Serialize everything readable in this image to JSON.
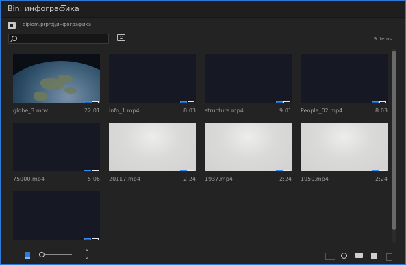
{
  "panel": {
    "title": "Bin: инфографика",
    "path": "diplom.prproj\\инфографика",
    "items_count": "9 Items"
  },
  "search": {
    "value": "",
    "placeholder": ""
  },
  "items": [
    {
      "name": "globe_3.mov",
      "duration": "22:01",
      "thumb": "globe"
    },
    {
      "name": "info_1.mp4",
      "duration": "8:03",
      "thumb": "dark"
    },
    {
      "name": "structure.mp4",
      "duration": "9:01",
      "thumb": "dark"
    },
    {
      "name": "People_02.mp4",
      "duration": "8:03",
      "thumb": "dark"
    },
    {
      "name": "75000.mp4",
      "duration": "5:06",
      "thumb": "dark"
    },
    {
      "name": "20117.mp4",
      "duration": "2:24",
      "thumb": "light"
    },
    {
      "name": "1937.mp4",
      "duration": "2:24",
      "thumb": "light"
    },
    {
      "name": "1950.mp4",
      "duration": "2:24",
      "thumb": "light"
    },
    {
      "name": "",
      "duration": "",
      "thumb": "dark"
    }
  ],
  "colors": {
    "accent": "#2e7ad6",
    "panel_bg": "#232323",
    "thumb_dark": "#161824"
  },
  "footer": {
    "icons": [
      "list-view-icon",
      "icon-view-icon",
      "zoom-slider",
      "sort-icon",
      "automate-to-sequence-icon",
      "find-icon",
      "new-bin-icon",
      "new-item-icon",
      "clear-icon"
    ]
  }
}
